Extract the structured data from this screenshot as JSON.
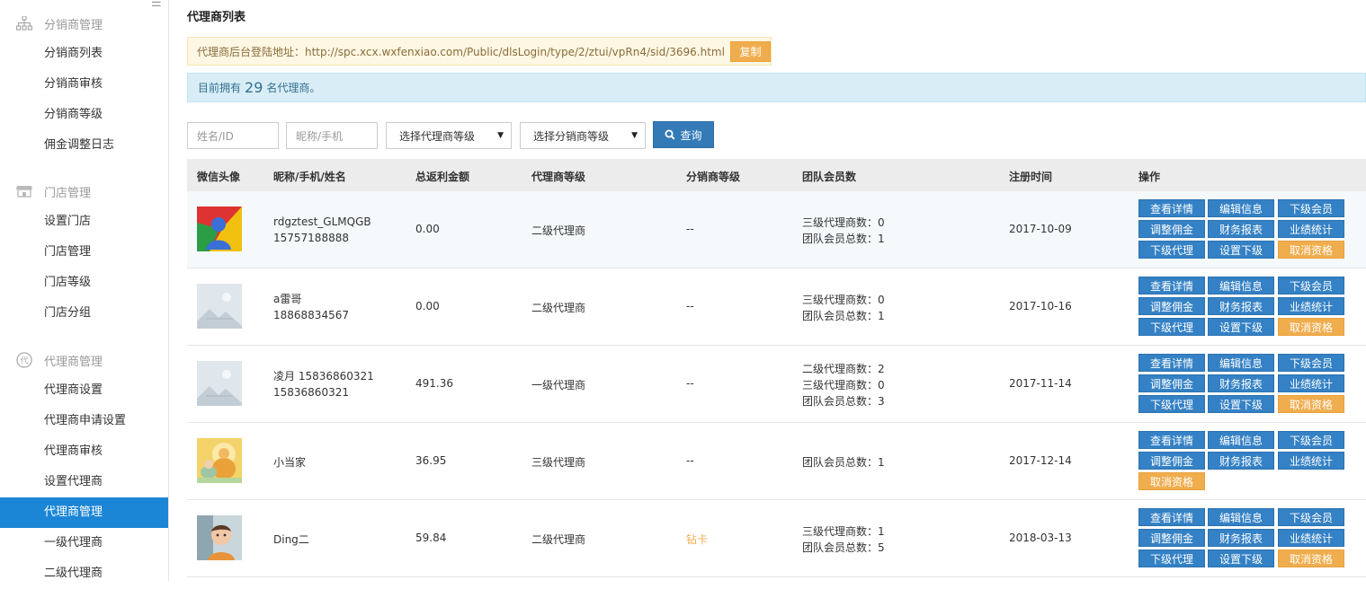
{
  "sidebar": {
    "collapse_icon": "menu-icon",
    "groups": [
      {
        "title": "分销商管理",
        "icon": "sitemap-icon",
        "items": [
          "分销商列表",
          "分销商审核",
          "分销商等级",
          "佣金调整日志"
        ]
      },
      {
        "title": "门店管理",
        "icon": "store-icon",
        "items": [
          "设置门店",
          "门店管理",
          "门店等级",
          "门店分组"
        ]
      },
      {
        "title": "代理商管理",
        "icon": "agent-icon",
        "icon_char": "代",
        "items": [
          "代理商设置",
          "代理商申请设置",
          "代理商审核",
          "设置代理商",
          "代理商管理",
          "一级代理商",
          "二级代理商"
        ]
      }
    ],
    "active_item": "代理商管理"
  },
  "page": {
    "title": "代理商列表",
    "login_url_text": "代理商后台登陆地址：http://spc.xcx.wxfenxiao.com/Public/dlsLogin/type/2/ztui/vpRn4/sid/3696.html",
    "copy_label": "复制",
    "info_prefix": "目前拥有",
    "info_count": "29",
    "info_suffix": "名代理商。"
  },
  "filters": {
    "name_placeholder": "姓名/ID",
    "nick_placeholder": "昵称/手机",
    "agent_level_selected": "选择代理商等级",
    "dist_level_selected": "选择分销商等级",
    "search_label": "查询"
  },
  "table": {
    "headers": [
      "微信头像",
      "昵称/手机/姓名",
      "总返利金额",
      "代理商等级",
      "分销商等级",
      "团队会员数",
      "注册时间",
      "操作"
    ],
    "rows": [
      {
        "nick": "rdgztest_GLMQGB",
        "phone": "15757188888",
        "amount": "0.00",
        "agent_level": "二级代理商",
        "dist_level": "--",
        "team": [
          "三级代理商数：0",
          "团队会员总数：1"
        ],
        "date": "2017-10-09",
        "avatar": "chrome-avatar"
      },
      {
        "nick": "a雷哥",
        "phone": "18868834567",
        "amount": "0.00",
        "agent_level": "二级代理商",
        "dist_level": "--",
        "team": [
          "三级代理商数：0",
          "团队会员总数：1"
        ],
        "date": "2017-10-16",
        "avatar": "placeholder-avatar"
      },
      {
        "nick": "凌月 15836860321",
        "phone": "15836860321",
        "amount": "491.36",
        "agent_level": "一级代理商",
        "dist_level": "--",
        "team": [
          "二级代理商数：2",
          "三级代理商数：0",
          "团队会员总数：3"
        ],
        "date": "2017-11-14",
        "avatar": "placeholder-avatar"
      },
      {
        "nick": "小当家",
        "phone": "",
        "amount": "36.95",
        "agent_level": "三级代理商",
        "dist_level": "--",
        "team": [
          "团队会员总数：1"
        ],
        "date": "2017-12-14",
        "avatar": "buddha-avatar"
      },
      {
        "nick": "Ding二",
        "phone": "",
        "amount": "59.84",
        "agent_level": "二级代理商",
        "dist_level": "钻卡",
        "dist_level_color": "#f0ad4e",
        "team": [
          "三级代理商数：1",
          "团队会员总数：5"
        ],
        "date": "2018-03-13",
        "avatar": "child-photo-avatar"
      }
    ],
    "ops_full": [
      "查看详情",
      "编辑信息",
      "下级会员",
      "调整佣金",
      "财务报表",
      "业绩统计",
      "下级代理",
      "设置下级",
      "取消资格"
    ],
    "ops_short": [
      "查看详情",
      "编辑信息",
      "下级会员",
      "调整佣金",
      "财务报表",
      "业绩统计",
      "取消资格"
    ]
  },
  "colors": {
    "primary": "#337ab7",
    "active_menu": "#1c86d6",
    "warning": "#f0ad4e",
    "info_bg": "#d9edf7"
  }
}
